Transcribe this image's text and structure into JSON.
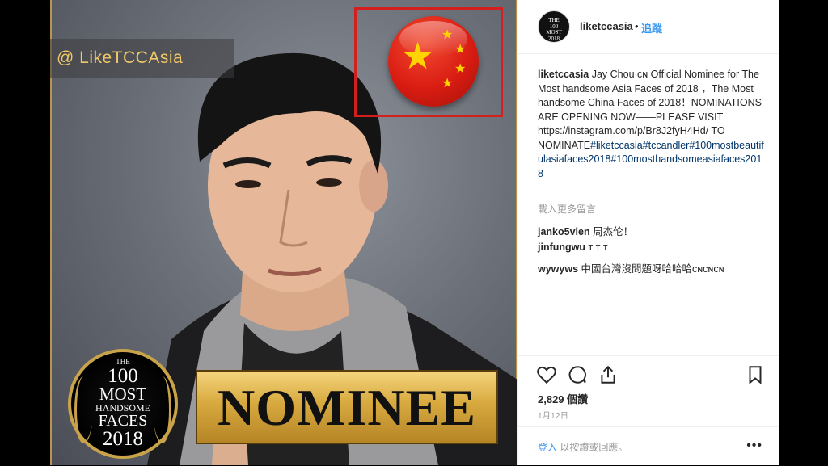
{
  "media": {
    "handle": "@ LikeTCCAsia",
    "nominee_label": "NOMINEE",
    "badge": {
      "line1": "THE",
      "line2": "100",
      "line3": "MOST",
      "line4": "HANDSOME",
      "line5": "FACES",
      "line6": "2018"
    },
    "avatar_text": {
      "l1": "THE",
      "l2": "100",
      "l3": "MOST",
      "l4": "2018"
    }
  },
  "header": {
    "username": "liketccasia",
    "separator": "•",
    "follow_label": "追蹤"
  },
  "caption": {
    "username": "liketccasia",
    "text": " Jay Chou ᴄɴ Official Nominee for The Most handsome Asia Faces of 2018 ，The Most handsome China Faces of 2018！NOMINATIONS ARE OPENING NOW——PLEASE VISIT https://instagram.com/p/Br8J2fyH4Hd/ TO NOMINATE",
    "hashtags": "#liketccasia#tccandler#100mostbeautifulasiafaces2018#100mosthandsomeasiafaces2018"
  },
  "load_more": "載入更多留言",
  "comments": [
    {
      "user": "janko5vlen",
      "text": " 周杰伦！"
    },
    {
      "user": "jinfungwu",
      "text": " ᴛ󠄀 ᴛ󠄀 ᴛ󠄀"
    },
    {
      "user": "wywyws",
      "text": " 中國台灣沒問題呀哈哈哈ᴄɴᴄɴᴄɴ"
    }
  ],
  "likes": "2,829 個讚",
  "date": "1月12日",
  "footer": {
    "login_link": "登入",
    "login_rest": " 以按讚或回應。",
    "options": "•••"
  },
  "colors": {
    "link": "#3897f0",
    "flag_red": "#d91c12",
    "star": "#ffd400",
    "gold": "#c9a349"
  },
  "icons": [
    "heart-icon",
    "comment-icon",
    "share-icon",
    "bookmark-icon",
    "more-options-icon"
  ]
}
